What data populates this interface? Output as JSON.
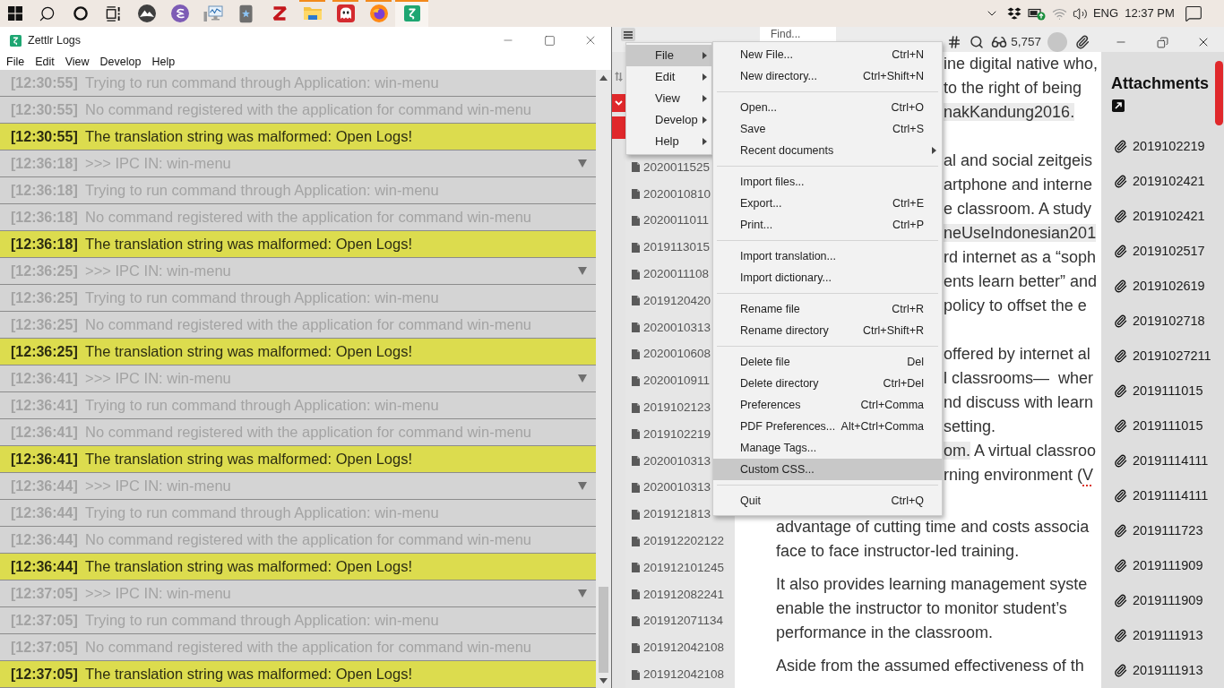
{
  "taskbar": {
    "apps": [
      {
        "kind": "mountain",
        "running": false,
        "active": false
      },
      {
        "kind": "swirl",
        "running": false,
        "active": false
      },
      {
        "kind": "monitor",
        "running": false,
        "active": false
      },
      {
        "kind": "device",
        "running": false,
        "active": false
      },
      {
        "kind": "zigzag",
        "running": false,
        "active": false
      },
      {
        "kind": "folder",
        "running": true,
        "active": false
      },
      {
        "kind": "ghost",
        "running": true,
        "active": false
      },
      {
        "kind": "globe",
        "running": true,
        "active": false
      },
      {
        "kind": "tile",
        "running": true,
        "active": true
      }
    ],
    "language": "ENG",
    "time": "12:37 PM"
  },
  "log_window": {
    "title": "Zettlr Logs",
    "menu": [
      "File",
      "Edit",
      "View",
      "Develop",
      "Help"
    ],
    "entries": [
      {
        "time": "[12:30:55]",
        "message": "Trying to run command through Application: win-menu",
        "kind": "verbose",
        "expandable": false
      },
      {
        "time": "[12:30:55]",
        "message": "No command registered with the application for command win-menu",
        "kind": "verbose",
        "expandable": false
      },
      {
        "time": "[12:30:55]",
        "message": "The translation string was malformed: Open Logs!",
        "kind": "warning",
        "expandable": false
      },
      {
        "time": "[12:36:18]",
        "message": ">>> IPC IN: win-menu",
        "kind": "verbose",
        "expandable": true
      },
      {
        "time": "[12:36:18]",
        "message": "Trying to run command through Application: win-menu",
        "kind": "verbose",
        "expandable": false
      },
      {
        "time": "[12:36:18]",
        "message": "No command registered with the application for command win-menu",
        "kind": "verbose",
        "expandable": false
      },
      {
        "time": "[12:36:18]",
        "message": "The translation string was malformed: Open Logs!",
        "kind": "warning",
        "expandable": false
      },
      {
        "time": "[12:36:25]",
        "message": ">>> IPC IN: win-menu",
        "kind": "verbose",
        "expandable": true
      },
      {
        "time": "[12:36:25]",
        "message": "Trying to run command through Application: win-menu",
        "kind": "verbose",
        "expandable": false
      },
      {
        "time": "[12:36:25]",
        "message": "No command registered with the application for command win-menu",
        "kind": "verbose",
        "expandable": false
      },
      {
        "time": "[12:36:25]",
        "message": "The translation string was malformed: Open Logs!",
        "kind": "warning",
        "expandable": false
      },
      {
        "time": "[12:36:41]",
        "message": ">>> IPC IN: win-menu",
        "kind": "verbose",
        "expandable": true
      },
      {
        "time": "[12:36:41]",
        "message": "Trying to run command through Application: win-menu",
        "kind": "verbose",
        "expandable": false
      },
      {
        "time": "[12:36:41]",
        "message": "No command registered with the application for command win-menu",
        "kind": "verbose",
        "expandable": false
      },
      {
        "time": "[12:36:41]",
        "message": "The translation string was malformed: Open Logs!",
        "kind": "warning",
        "expandable": false
      },
      {
        "time": "[12:36:44]",
        "message": ">>> IPC IN: win-menu",
        "kind": "verbose",
        "expandable": true
      },
      {
        "time": "[12:36:44]",
        "message": "Trying to run command through Application: win-menu",
        "kind": "verbose",
        "expandable": false
      },
      {
        "time": "[12:36:44]",
        "message": "No command registered with the application for command win-menu",
        "kind": "verbose",
        "expandable": false
      },
      {
        "time": "[12:36:44]",
        "message": "The translation string was malformed: Open Logs!",
        "kind": "warning",
        "expandable": false
      },
      {
        "time": "[12:37:05]",
        "message": ">>> IPC IN: win-menu",
        "kind": "verbose",
        "expandable": true
      },
      {
        "time": "[12:37:05]",
        "message": "Trying to run command through Application: win-menu",
        "kind": "verbose",
        "expandable": false
      },
      {
        "time": "[12:37:05]",
        "message": "No command registered with the application for command win-menu",
        "kind": "verbose",
        "expandable": false
      },
      {
        "time": "[12:37:05]",
        "message": "The translation string was malformed: Open Logs!",
        "kind": "warning",
        "expandable": false
      }
    ]
  },
  "main_window": {
    "toolbar": {
      "search": {
        "placeholder": "Find..."
      },
      "word_count": "5,757"
    },
    "sidebar": {
      "files": [
        "2020011525",
        "2020010810",
        "2020011011",
        "2019113015",
        "2020011108",
        "2019120420",
        "2020010313",
        "2020010608",
        "2020010911",
        "2019102123",
        "2019102219",
        "2020010313",
        "2020010313",
        "2019121813",
        "201912202122",
        "201912101245",
        "201912082241",
        "201912071134",
        "201912042108",
        "201912042108"
      ]
    },
    "menu": {
      "items": [
        {
          "label": "File",
          "selected": true,
          "has_submenu": true
        },
        {
          "label": "Edit",
          "selected": false,
          "has_submenu": true
        },
        {
          "label": "View",
          "selected": false,
          "has_submenu": true
        },
        {
          "label": "Develop",
          "selected": false,
          "has_submenu": true
        },
        {
          "label": "Help",
          "selected": false,
          "has_submenu": true
        }
      ],
      "submenu": {
        "groups": [
          {
            "items": [
              {
                "label": "New File...",
                "shortcut": "Ctrl+N",
                "has_submenu": false,
                "selected": false
              },
              {
                "label": "New directory...",
                "shortcut": "Ctrl+Shift+N",
                "has_submenu": false,
                "selected": false
              }
            ]
          },
          {
            "items": [
              {
                "label": "Open...",
                "shortcut": "Ctrl+O",
                "has_submenu": false,
                "selected": false
              },
              {
                "label": "Save",
                "shortcut": "Ctrl+S",
                "has_submenu": false,
                "selected": false
              },
              {
                "label": "Recent documents",
                "has_submenu": true,
                "selected": false
              }
            ]
          },
          {
            "items": [
              {
                "label": "Import files...",
                "has_submenu": false,
                "selected": false
              },
              {
                "label": "Export...",
                "shortcut": "Ctrl+E",
                "has_submenu": false,
                "selected": false
              },
              {
                "label": "Print...",
                "shortcut": "Ctrl+P",
                "has_submenu": false,
                "selected": false
              }
            ]
          },
          {
            "items": [
              {
                "label": "Import translation...",
                "has_submenu": false,
                "selected": false
              },
              {
                "label": "Import dictionary...",
                "has_submenu": false,
                "selected": false
              }
            ]
          },
          {
            "items": [
              {
                "label": "Rename file",
                "shortcut": "Ctrl+R",
                "has_submenu": false,
                "selected": false
              },
              {
                "label": "Rename directory",
                "shortcut": "Ctrl+Shift+R",
                "has_submenu": false,
                "selected": false
              }
            ]
          },
          {
            "items": [
              {
                "label": "Delete file",
                "shortcut": "Del",
                "has_submenu": false,
                "selected": false
              },
              {
                "label": "Delete directory",
                "shortcut": "Ctrl+Del",
                "has_submenu": false,
                "selected": false
              },
              {
                "label": "Preferences",
                "shortcut": "Ctrl+Comma",
                "has_submenu": false,
                "selected": false
              },
              {
                "label": "PDF Preferences...",
                "shortcut": "Alt+Ctrl+Comma",
                "has_submenu": false,
                "selected": false
              },
              {
                "label": "Manage Tags...",
                "has_submenu": false,
                "selected": false
              },
              {
                "label": "Custom CSS...",
                "has_submenu": false,
                "selected": true
              }
            ]
          },
          {
            "items": [
              {
                "label": "Quit",
                "shortcut": "Ctrl+Q",
                "has_submenu": false,
                "selected": false
              }
            ]
          }
        ]
      }
    },
    "editor": {
      "paragraphs": [
        {
          "lines": [
            {
              "starts_under_menu": true,
              "parts": [
                {
                  "text": "ine digital native who,",
                  "kind": "plain"
                }
              ]
            },
            {
              "starts_under_menu": true,
              "parts": [
                {
                  "text": "to the right of being",
                  "kind": "plain"
                }
              ]
            },
            {
              "starts_under_menu": true,
              "parts": [
                {
                  "text": "nakKandung2016.",
                  "kind": "citation"
                }
              ]
            }
          ]
        },
        {
          "lines": [
            {
              "starts_under_menu": true,
              "parts": [
                {
                  "text": "al and social zeitgeis",
                  "kind": "plain"
                }
              ]
            },
            {
              "starts_under_menu": true,
              "parts": [
                {
                  "text": "artphone and interne",
                  "kind": "plain"
                }
              ]
            },
            {
              "starts_under_menu": true,
              "parts": [
                {
                  "text": "e classroom. A study",
                  "kind": "plain"
                }
              ]
            },
            {
              "starts_under_menu": true,
              "parts": [
                {
                  "text": "neUseIndonesian201",
                  "kind": "citation"
                }
              ]
            },
            {
              "starts_under_menu": true,
              "parts": [
                {
                  "text": "rd internet as a “soph",
                  "kind": "plain"
                }
              ]
            },
            {
              "starts_under_menu": true,
              "parts": [
                {
                  "text": "ents learn better” and",
                  "kind": "plain"
                }
              ]
            },
            {
              "starts_under_menu": true,
              "parts": [
                {
                  "text": "policy to offset the e",
                  "kind": "plain"
                }
              ]
            }
          ]
        },
        {
          "lines": [
            {
              "starts_under_menu": true,
              "parts": [
                {
                  "text": "offered by internet al",
                  "kind": "plain"
                }
              ]
            },
            {
              "starts_under_menu": true,
              "parts": [
                {
                  "text": "l classrooms—  wher",
                  "kind": "plain"
                }
              ]
            },
            {
              "starts_under_menu": true,
              "parts": [
                {
                  "text": "nd discuss with learn",
                  "kind": "plain"
                }
              ]
            },
            {
              "starts_under_menu": true,
              "parts": [
                {
                  "text": "setting.",
                  "kind": "plain"
                }
              ]
            },
            {
              "starts_under_menu": true,
              "parts": [
                {
                  "text": "om.",
                  "kind": "citation"
                },
                {
                  "text": " A virtual classroo",
                  "kind": "plain"
                }
              ]
            },
            {
              "starts_under_menu": true,
              "parts": [
                {
                  "text": "rning environment (",
                  "kind": "plain"
                },
                {
                  "text": "V",
                  "kind": "misspelled"
                }
              ]
            },
            {
              "starts_under_menu": false,
              "parts": [
                {
                  "text": "advantage of cutting time and costs associa",
                  "kind": "plain"
                }
              ]
            },
            {
              "starts_under_menu": false,
              "parts": [
                {
                  "text": "face to face instructor-led training.",
                  "kind": "plain"
                }
              ]
            }
          ]
        },
        {
          "lines": [
            {
              "starts_under_menu": false,
              "parts": [
                {
                  "text": "It also provides learning management syste",
                  "kind": "plain"
                }
              ]
            },
            {
              "starts_under_menu": false,
              "parts": [
                {
                  "text": "enable the instructor to monitor student’s",
                  "kind": "plain"
                }
              ]
            },
            {
              "starts_under_menu": false,
              "parts": [
                {
                  "text": "performance in the classroom.",
                  "kind": "plain"
                }
              ]
            }
          ]
        },
        {
          "lines": [
            {
              "starts_under_menu": false,
              "parts": [
                {
                  "text": "Aside from the assumed effectiveness of th",
                  "kind": "plain"
                }
              ]
            }
          ]
        }
      ]
    },
    "attachments": {
      "title": "Attachments",
      "files": [
        "2019102219",
        "2019102421",
        "2019102421",
        "2019102517",
        "2019102619",
        "2019102718",
        "20191027211",
        "2019111015",
        "2019111015",
        "20191114111",
        "20191114111",
        "2019111723",
        "2019111909",
        "2019111909",
        "2019111913",
        "2019111913"
      ]
    }
  }
}
